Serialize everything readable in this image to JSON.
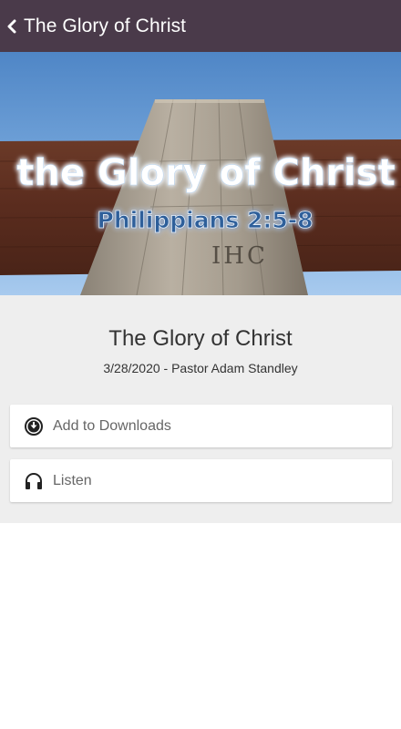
{
  "header": {
    "title": "The Glory of Christ",
    "back_icon": "chevron-left-icon",
    "background_color": "#4a3a4a"
  },
  "hero": {
    "line1": "the Glory of Christ",
    "line2": "Philippians 2:5-8",
    "carving": "IHC"
  },
  "sermon": {
    "title": "The Glory of Christ",
    "meta": "3/28/2020 - Pastor Adam Standley"
  },
  "actions": [
    {
      "label": "Add to Downloads",
      "icon": "download-circle-icon"
    },
    {
      "label": "Listen",
      "icon": "headphones-icon"
    }
  ]
}
